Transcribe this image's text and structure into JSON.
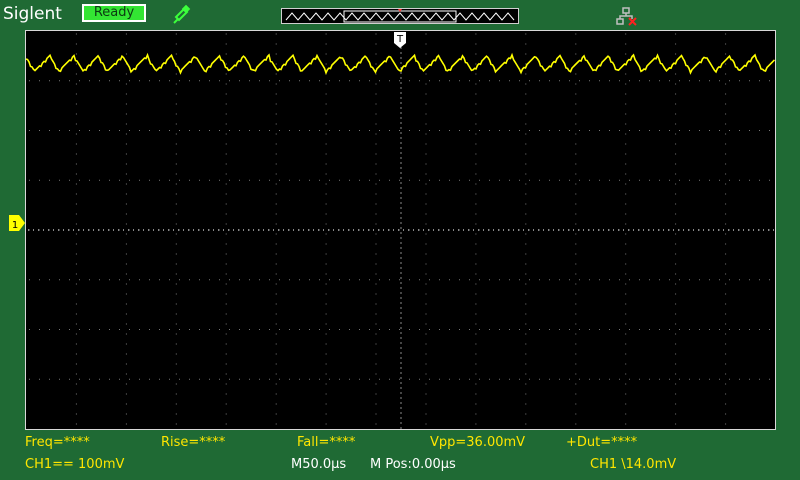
{
  "header": {
    "brand": "Siglent",
    "status": "Ready",
    "icons": [
      "probe-icon",
      "usb-network-disconnected-icon"
    ]
  },
  "trigger": {
    "position_marker": "T",
    "channel_marker": "1"
  },
  "measurements": {
    "freq": "Freq=****",
    "rise": "Rise=****",
    "fall": "Fall=****",
    "vpp": "Vpp=36.00mV",
    "duty": "+Dut=****"
  },
  "status_bar": {
    "ch1_scale": "CH1== 100mV",
    "timebase": "M50.0μs",
    "mpos": "M Pos:0.00μs",
    "trigger_info": "CH1 \\14.0mV"
  },
  "colors": {
    "background": "#1f6a34",
    "trace": "#ffff00",
    "measurement_text": "#ffe600",
    "ready": "#33e533"
  }
}
